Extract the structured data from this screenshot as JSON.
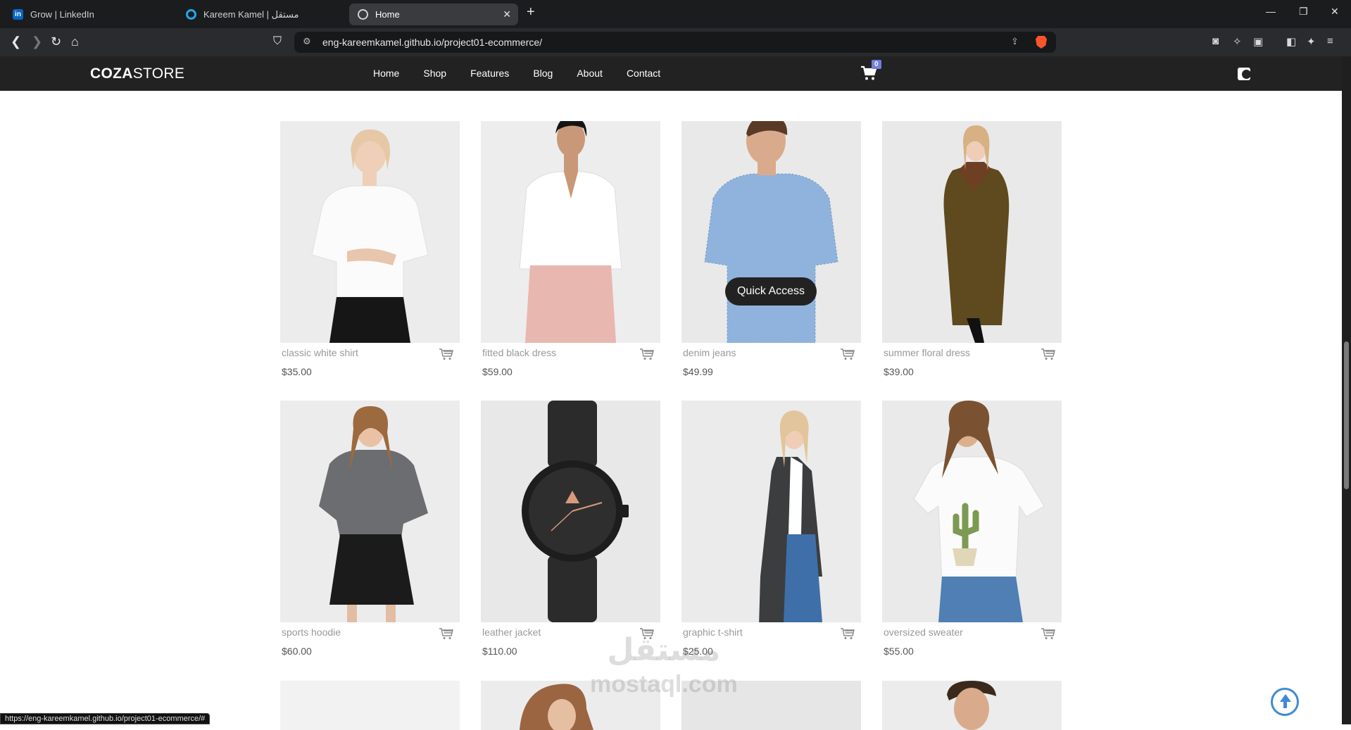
{
  "browser": {
    "tabs": [
      {
        "title": "Grow | LinkedIn",
        "favicon": "linkedin-icon",
        "active": false
      },
      {
        "title": "Kareem Kamel | مستقل",
        "favicon": "mostaql-icon",
        "active": false
      },
      {
        "title": "Home",
        "favicon": "globe-icon",
        "active": true
      }
    ],
    "url": "eng-kareemkamel.github.io/project01-ecommerce/",
    "status_url": "https://eng-kareemkamel.github.io/project01-ecommerce/#"
  },
  "site": {
    "logo_bold": "COZA",
    "logo_rest": "STORE",
    "menu": [
      "Home",
      "Shop",
      "Features",
      "Blog",
      "About",
      "Contact"
    ],
    "cart_count": "0",
    "quick_access_label": "Quick Access"
  },
  "products": [
    {
      "name": "classic white shirt",
      "price": "$35.00"
    },
    {
      "name": "fitted black dress",
      "price": "$59.00"
    },
    {
      "name": "denim jeans",
      "price": "$49.99"
    },
    {
      "name": "summer floral dress",
      "price": "$39.00"
    },
    {
      "name": "sports hoodie",
      "price": "$60.00"
    },
    {
      "name": "leather jacket",
      "price": "$110.00"
    },
    {
      "name": "graphic t-shirt",
      "price": "$25.00"
    },
    {
      "name": "oversized sweater",
      "price": "$55.00"
    }
  ],
  "watermark": {
    "line1": "مستقل",
    "line2": "mostaql.com"
  },
  "colors": {
    "nav_bg": "#222222",
    "accent": "#717fe0",
    "scroll_btn": "#3d8bd4"
  }
}
